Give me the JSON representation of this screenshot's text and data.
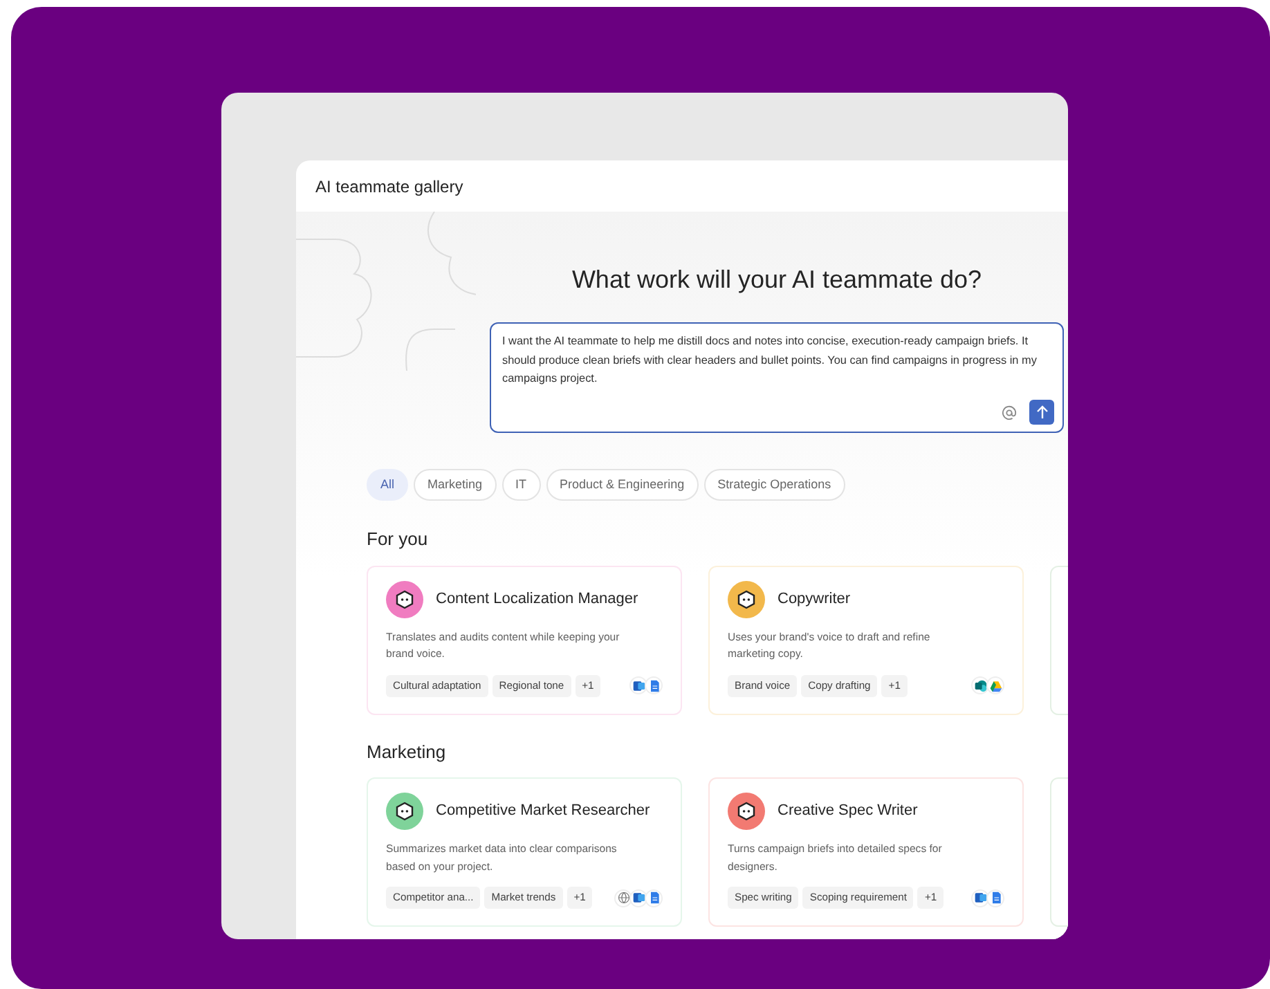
{
  "window": {
    "title": "AI teammate gallery"
  },
  "heading": "What work will your AI teammate do?",
  "prompt": {
    "value": "I want the AI teammate to help me distill docs and notes into concise, execution-ready campaign briefs. It should produce clean briefs with clear headers and bullet points. You can find campaigns in progress in my campaigns project."
  },
  "filters": [
    {
      "label": "All",
      "selected": true
    },
    {
      "label": "Marketing",
      "selected": false
    },
    {
      "label": "IT",
      "selected": false
    },
    {
      "label": "Product & Engineering",
      "selected": false
    },
    {
      "label": "Strategic Operations",
      "selected": false
    }
  ],
  "sections": [
    {
      "title": "For you",
      "cards": [
        {
          "name": "Content Localization Manager",
          "description": "Translates and audits content while keeping your brand voice.",
          "color": "#f07cc0",
          "tags": [
            "Cultural adaptation",
            "Regional tone",
            "+1"
          ],
          "apps": [
            {
              "kind": "word"
            },
            {
              "kind": "docs"
            }
          ]
        },
        {
          "name": "Copywriter",
          "description": "Uses your brand's voice to draft and refine marketing copy.",
          "color": "#f2b84b",
          "tags": [
            "Brand voice",
            "Copy drafting",
            "+1"
          ],
          "apps": [
            {
              "kind": "sharepoint"
            },
            {
              "kind": "drive"
            }
          ]
        }
      ]
    },
    {
      "title": "Marketing",
      "cards": [
        {
          "name": "Competitive Market Researcher",
          "description": "Summarizes market data into clear comparisons based on your project.",
          "color": "#7fd39a",
          "tags": [
            "Competitor ana...",
            "Market trends",
            "+1"
          ],
          "apps": [
            {
              "kind": "web"
            },
            {
              "kind": "word"
            },
            {
              "kind": "docs"
            }
          ]
        },
        {
          "name": "Creative Spec Writer",
          "description": "Turns campaign briefs into detailed specs for designers.",
          "color": "#f27a72",
          "tags": [
            "Spec writing",
            "Scoping requirement",
            "+1"
          ],
          "apps": [
            {
              "kind": "word"
            },
            {
              "kind": "docs"
            }
          ]
        }
      ]
    }
  ]
}
